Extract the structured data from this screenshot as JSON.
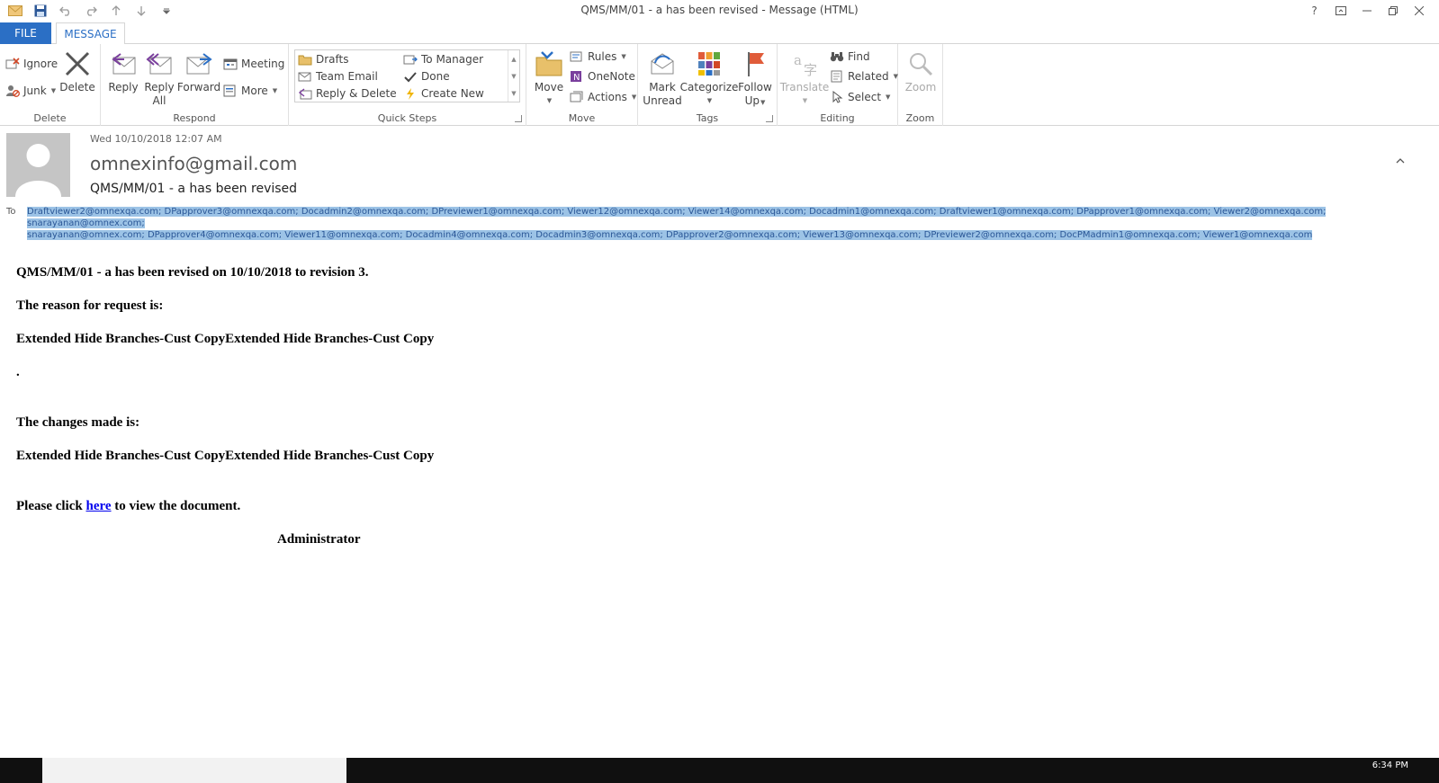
{
  "window": {
    "title": "QMS/MM/01 - a  has been revised - Message (HTML)",
    "controls": {
      "help": "?"
    }
  },
  "tabs": {
    "file": "FILE",
    "message": "MESSAGE"
  },
  "ribbon": {
    "delete_group": {
      "label": "Delete",
      "ignore": "Ignore",
      "junk": "Junk",
      "delete": "Delete"
    },
    "respond_group": {
      "label": "Respond",
      "reply": "Reply",
      "reply_all_1": "Reply",
      "reply_all_2": "All",
      "forward": "Forward",
      "meeting": "Meeting",
      "more": "More"
    },
    "quick_steps_group": {
      "label": "Quick Steps",
      "items": [
        "Drafts",
        "Team Email",
        "Reply & Delete",
        "To Manager",
        "Done",
        "Create New"
      ]
    },
    "move_group": {
      "label": "Move",
      "move": "Move",
      "rules": "Rules",
      "onenote": "OneNote",
      "actions": "Actions"
    },
    "tags_group": {
      "label": "Tags",
      "mark_unread_1": "Mark",
      "mark_unread_2": "Unread",
      "categorize": "Categorize",
      "follow_up_1": "Follow",
      "follow_up_2": "Up"
    },
    "editing_group": {
      "label": "Editing",
      "translate": "Translate",
      "find": "Find",
      "related": "Related",
      "select": "Select"
    },
    "zoom_group": {
      "label": "Zoom",
      "zoom": "Zoom"
    }
  },
  "header": {
    "sent": "Wed 10/10/2018 12:07 AM",
    "sender": "omnexinfo@gmail.com",
    "subject": "QMS/MM/01 - a  has been revised",
    "to_label": "To",
    "recipients_line1": "Draftviewer2@omnexqa.com; DPapprover3@omnexqa.com; Docadmin2@omnexqa.com; DPreviewer1@omnexqa.com; Viewer12@omnexqa.com; Viewer14@omnexqa.com; Docadmin1@omnexqa.com; Draftviewer1@omnexqa.com; DPapprover1@omnexqa.com; Viewer2@omnexqa.com; snarayanan@omnex.com;",
    "recipients_line2": "snarayanan@omnex.com; DPapprover4@omnexqa.com; Viewer11@omnexqa.com; Docadmin4@omnexqa.com; Docadmin3@omnexqa.com; DPapprover2@omnexqa.com; Viewer13@omnexqa.com; DPreviewer2@omnexqa.com; DocPMadmin1@omnexqa.com; Viewer1@omnexqa.com"
  },
  "body": {
    "line1": "QMS/MM/01 - a has been revised on 10/10/2018 to revision 3.",
    "line2": "The reason for request is:",
    "line3": "Extended Hide Branches-Cust CopyExtended Hide Branches-Cust Copy",
    "line4": ".",
    "line5": "The changes made is:",
    "line6": "Extended Hide Branches-Cust CopyExtended Hide Branches-Cust Copy",
    "click_prefix": "Please click ",
    "click_link": "here",
    "click_suffix": " to view the document.",
    "signature": "Administrator"
  },
  "taskbar": {
    "time": "6:34 PM"
  },
  "colors": {
    "accent": "#2b6fc5",
    "selection": "#9cc3e6",
    "link": "#0000ee"
  }
}
